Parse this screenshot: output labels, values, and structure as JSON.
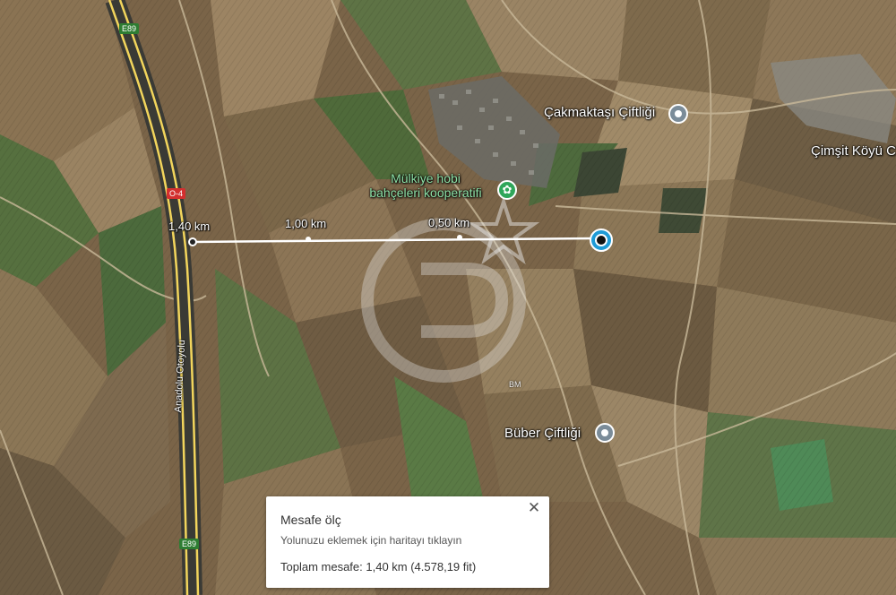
{
  "places": {
    "cakmaktasi": "Çakmaktaşı Çiftliği",
    "cimsit": "Çimşit Köyü C",
    "buber": "Büber Çiftliği",
    "mulkiye_line1": "Mülkiye hobi",
    "mulkiye_line2": "bahçeleri kooperatifi",
    "bm": "BM"
  },
  "roads": {
    "anadolu": "Anadolu Otoyolu",
    "shield_top": "E89",
    "shield_bottom": "E89",
    "shield_o4": "O-4"
  },
  "measure": {
    "label_total": "1,40 km",
    "label_mid": "1,00 km",
    "label_half": "0,50 km"
  },
  "panel": {
    "title": "Mesafe ölç",
    "hint": "Yolunuzu eklemek için haritayı tıklayın",
    "total": "Toplam mesafe: 1,40 km (4.578,19 fit)",
    "close": "✕"
  },
  "colors": {
    "field_brown": "#7a6448",
    "field_green": "#4f6b3a",
    "highway": "#f2d55c",
    "poi_green": "#2fa65a",
    "pin_gray": "#7b8c99",
    "measure_line": "#ffffff",
    "endpoint_cyan": "#1e9bd7"
  },
  "icons": {
    "place_pin": "location-pin-icon",
    "poi_pin": "flower-icon",
    "close": "close-icon"
  }
}
